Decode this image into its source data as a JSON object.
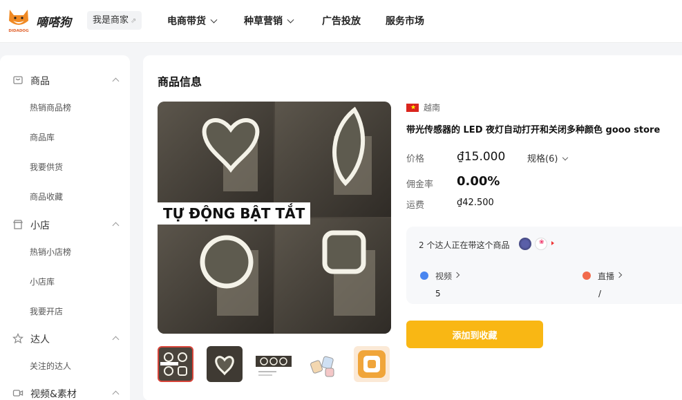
{
  "header": {
    "brand": "嘀嗒狗",
    "logo_text": "DIDADOG",
    "merchant_label": "我是商家",
    "nav": [
      {
        "label": "电商带货",
        "dropdown": true
      },
      {
        "label": "种草营销",
        "dropdown": true
      },
      {
        "label": "广告投放",
        "dropdown": false
      },
      {
        "label": "服务市场",
        "dropdown": false
      }
    ]
  },
  "sidebar": {
    "sections": [
      {
        "label": "商品",
        "icon": "product-icon",
        "items": [
          "热销商品榜",
          "商品库",
          "我要供货",
          "商品收藏"
        ]
      },
      {
        "label": "小店",
        "icon": "shop-icon",
        "items": [
          "热销小店榜",
          "小店库",
          "我要开店"
        ]
      },
      {
        "label": "达人",
        "icon": "star-icon",
        "items": [
          "关注的达人"
        ]
      },
      {
        "label": "视频&素材",
        "icon": "video-icon",
        "items": []
      }
    ]
  },
  "main": {
    "title": "商品信息",
    "image_banner": "TỰ ĐỘNG BẬT TẮT",
    "country": "越南",
    "product_title": "带光传感器的 LED 夜灯自动打开和关闭多种颜色 gooo store",
    "price_label": "价格",
    "price": "₫15.000",
    "spec_label": "规格(6)",
    "commission_label": "佣金率",
    "commission": "0.00%",
    "shipping_label": "运费",
    "shipping": "₫42.500",
    "creators_text": "2 个达人正在带这个商品",
    "video_label": "视频",
    "video_count": "5",
    "live_label": "直播",
    "live_count": "/",
    "add_button": "添加到收藏"
  },
  "colors": {
    "accent": "#f9b714",
    "flag_red": "#da251d",
    "logo_orange": "#f08a24"
  }
}
